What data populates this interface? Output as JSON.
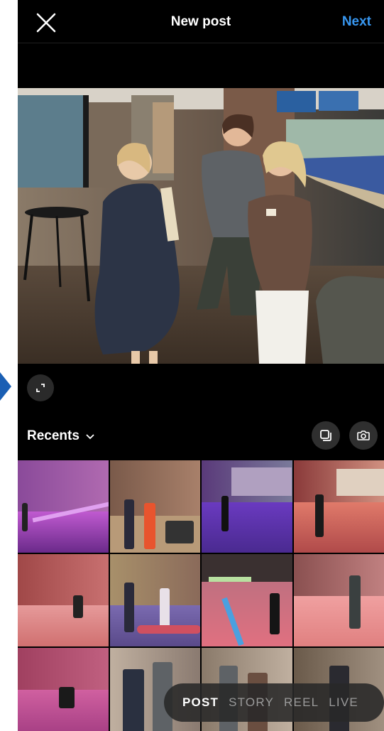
{
  "header": {
    "title": "New post",
    "next_label": "Next",
    "close_icon": "close-icon"
  },
  "preview": {
    "expand_icon": "expand-icon"
  },
  "gallery": {
    "album_label": "Recents",
    "multi_select_icon": "multi-select-icon",
    "camera_icon": "camera-icon"
  },
  "modes": {
    "items": [
      {
        "label": "POST",
        "active": true
      },
      {
        "label": "STORY",
        "active": false
      },
      {
        "label": "REEL",
        "active": false
      },
      {
        "label": "LIVE",
        "active": false
      }
    ]
  },
  "colors": {
    "background": "#000000",
    "accent": "#3897f0",
    "annotation_arrow": "#1a5fb4"
  }
}
